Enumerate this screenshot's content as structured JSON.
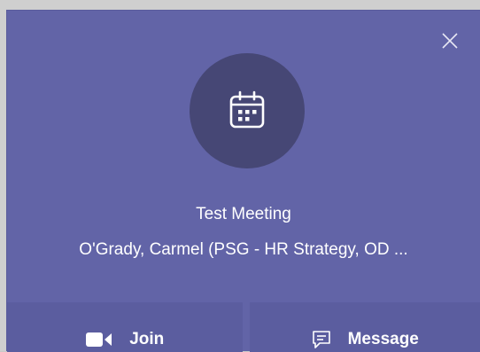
{
  "toast": {
    "title": "Test Meeting",
    "organizer": "O'Grady, Carmel (PSG - HR Strategy, OD ...",
    "icons": {
      "close": "close-icon",
      "avatar": "calendar-icon",
      "join": "video-camera-icon",
      "message": "chat-message-icon"
    },
    "colors": {
      "background": "#6264a7",
      "avatar": "#464775",
      "action": "#5b5d9f"
    }
  },
  "actions": {
    "join_label": "Join",
    "message_label": "Message"
  }
}
